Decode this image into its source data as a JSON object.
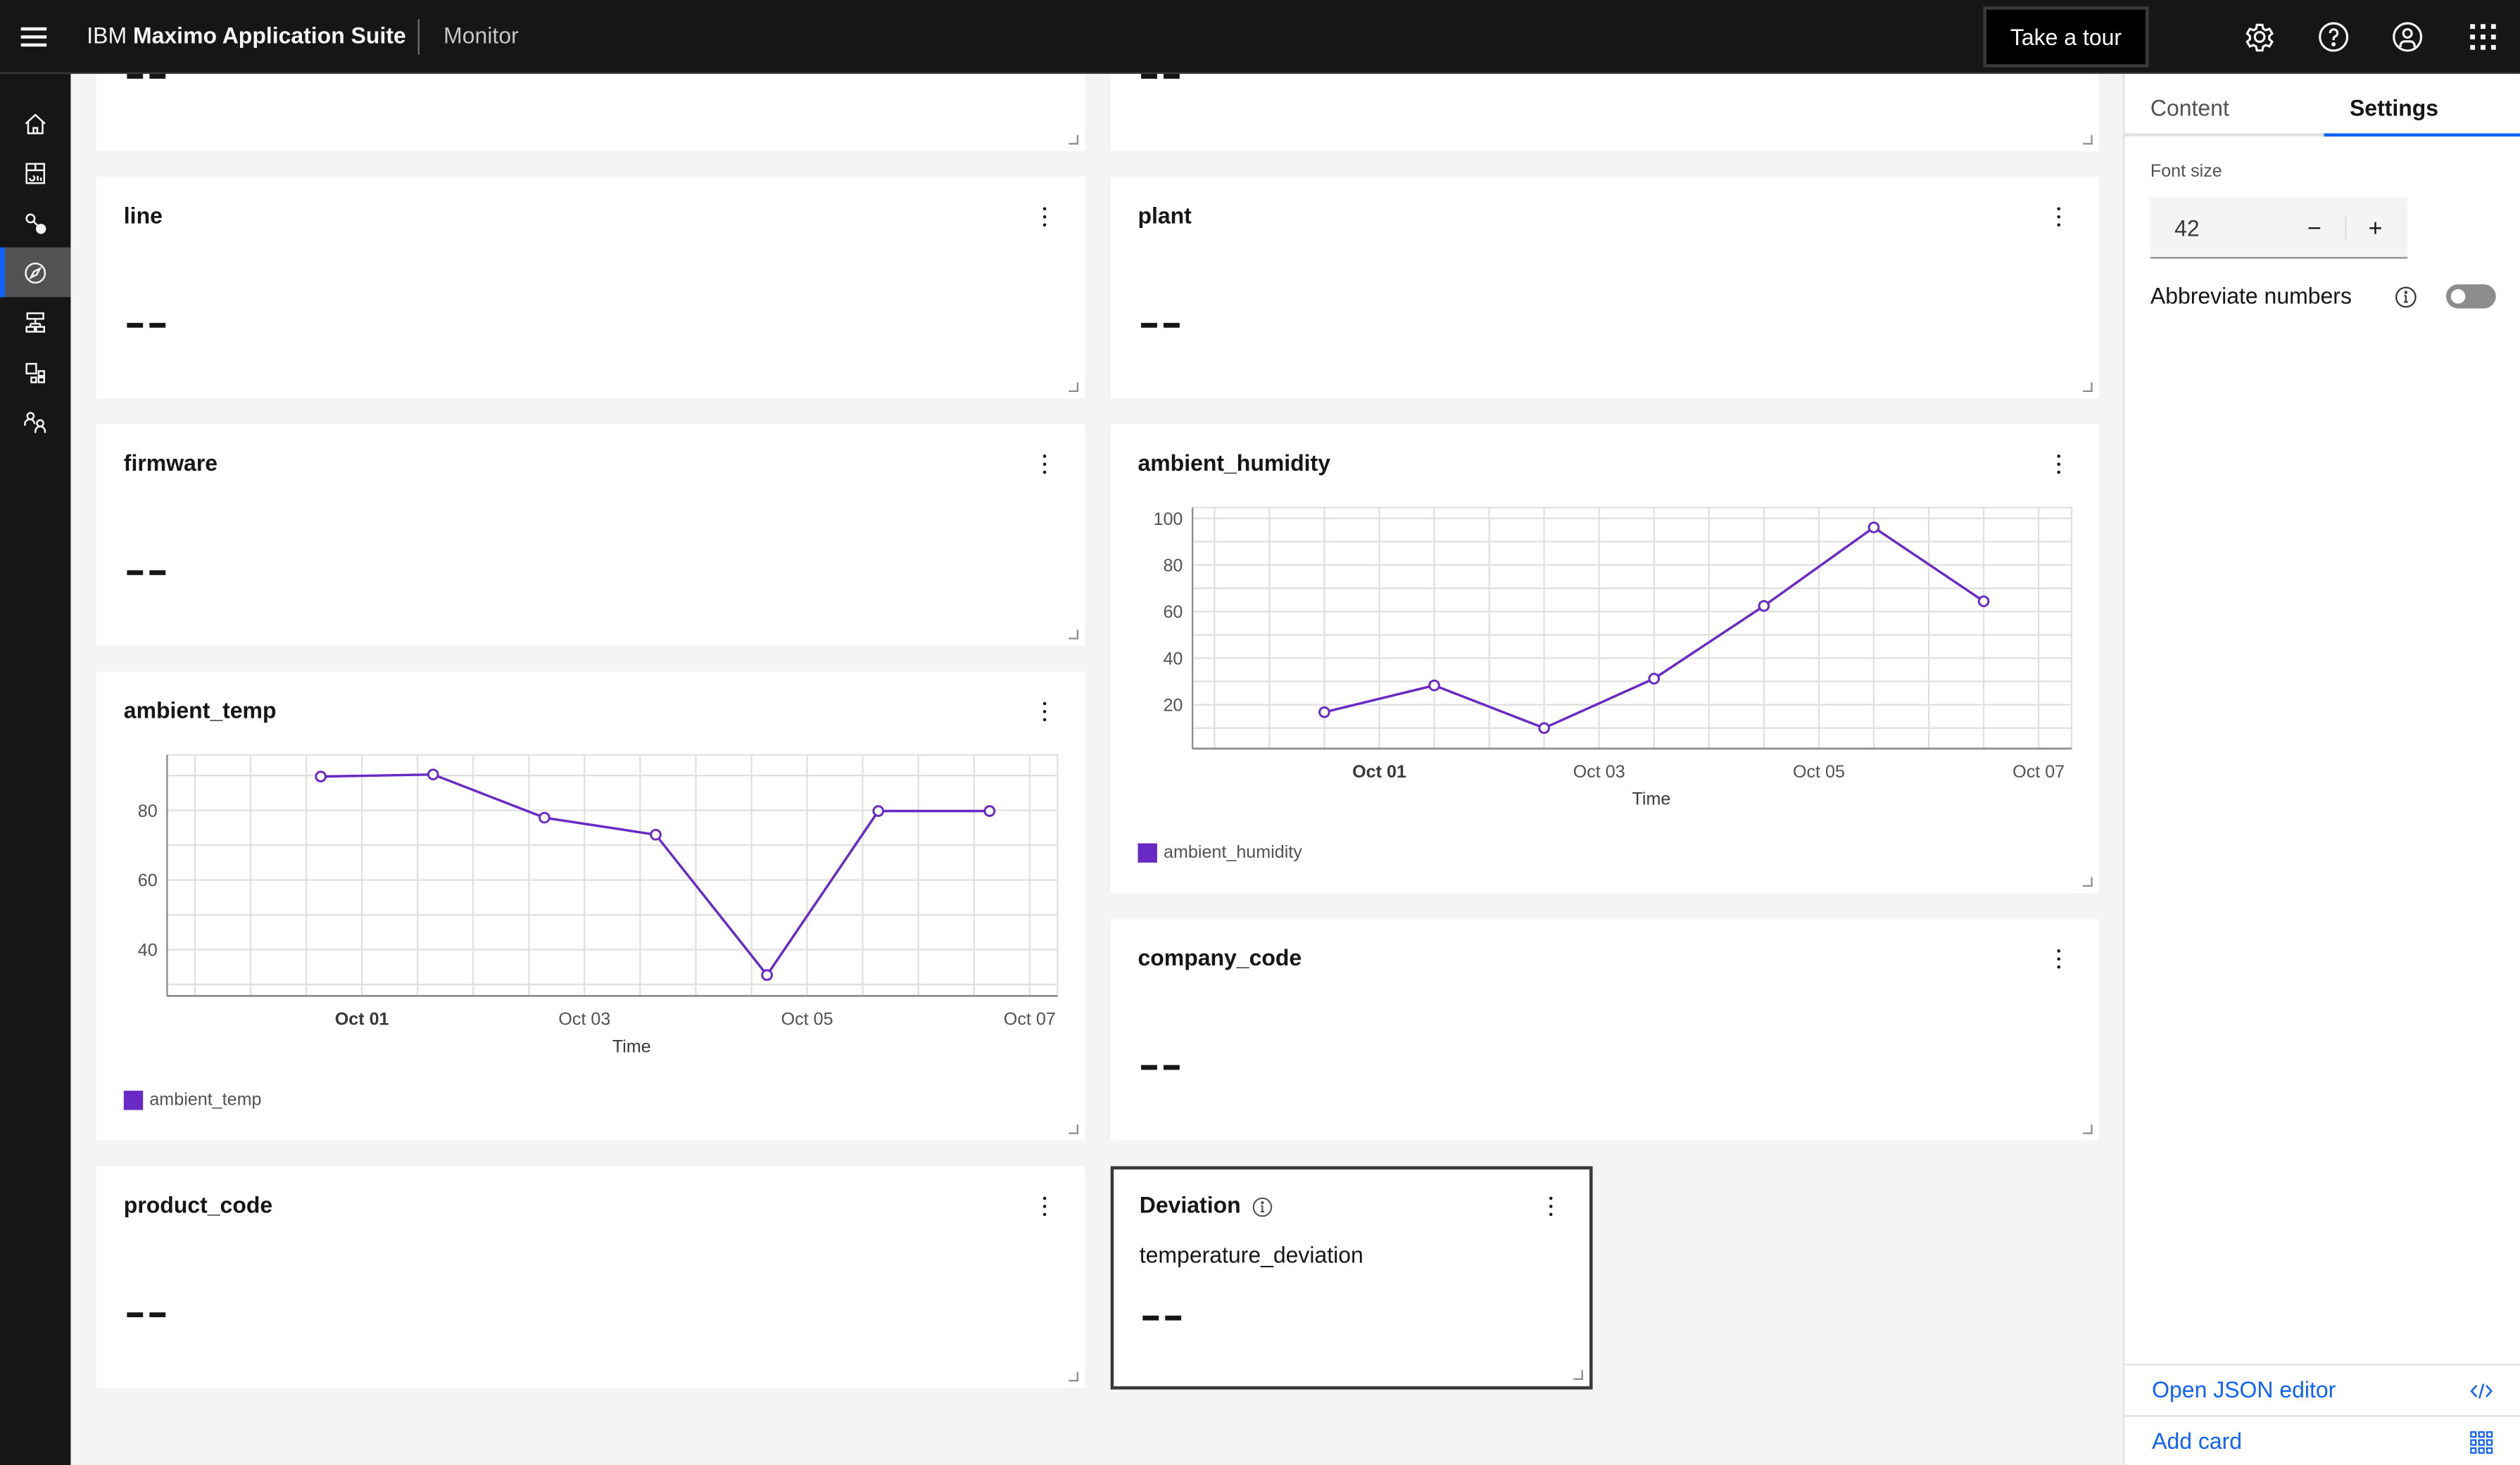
{
  "header": {
    "brand_prefix": "IBM",
    "brand_name": "Maximo Application Suite",
    "app_name": "Monitor",
    "tour_button": "Take a tour",
    "icons": [
      "settings-icon",
      "help-icon",
      "user-avatar-icon",
      "app-switcher-icon"
    ]
  },
  "leftnav": {
    "items": [
      {
        "name": "home",
        "icon": "home-icon",
        "active": false
      },
      {
        "name": "dashboards",
        "icon": "dashboard-icon",
        "active": false
      },
      {
        "name": "connect",
        "icon": "connect-icon",
        "active": false
      },
      {
        "name": "monitor",
        "icon": "compass-icon",
        "active": true
      },
      {
        "name": "hierarchy",
        "icon": "hierarchy-icon",
        "active": false
      },
      {
        "name": "apps",
        "icon": "apps-icon",
        "active": false
      },
      {
        "name": "users",
        "icon": "users-icon",
        "active": false
      }
    ]
  },
  "cards": {
    "top_left": {
      "title": "",
      "value": "--"
    },
    "top_right": {
      "title": "",
      "value": "--"
    },
    "line": {
      "title": "line",
      "value": "--"
    },
    "plant": {
      "title": "plant",
      "value": "--"
    },
    "firmware": {
      "title": "firmware",
      "value": "--"
    },
    "ambient_humidity": {
      "title": "ambient_humidity"
    },
    "ambient_temp": {
      "title": "ambient_temp"
    },
    "company_code": {
      "title": "company_code",
      "value": "--"
    },
    "product_code": {
      "title": "product_code",
      "value": "--"
    },
    "deviation": {
      "title": "Deviation",
      "subtitle": "temperature_deviation",
      "value": "--",
      "selected": true
    }
  },
  "chart_data": [
    {
      "type": "line",
      "title": "ambient_temp",
      "xlabel": "Time",
      "ylabel": "",
      "x_ticks": [
        "Oct 01",
        "Oct 03",
        "Oct 05",
        "Oct 07"
      ],
      "x_tick_bold": [
        "Oct 01"
      ],
      "x_days": [
        0.63,
        1.64,
        2.64,
        3.64,
        4.64,
        5.64,
        6.64
      ],
      "x_range_days": [
        -0.75,
        7.25
      ],
      "y_ticks": [
        40,
        60,
        80
      ],
      "ylim": [
        26.7,
        95.9
      ],
      "grid": true,
      "legend": "bottom-left",
      "color": "#6929c4",
      "series": [
        {
          "name": "ambient_temp",
          "values": [
            89.7,
            90.3,
            77.9,
            73.0,
            32.7,
            79.8,
            79.8
          ]
        }
      ]
    },
    {
      "type": "line",
      "title": "ambient_humidity",
      "xlabel": "Time",
      "ylabel": "",
      "x_ticks": [
        "Oct 01",
        "Oct 03",
        "Oct 05",
        "Oct 07"
      ],
      "x_tick_bold": [
        "Oct 01"
      ],
      "x_days": [
        0.5,
        1.5,
        2.5,
        3.5,
        4.5,
        5.5,
        6.5
      ],
      "x_range_days": [
        -0.7,
        7.3
      ],
      "y_ticks": [
        20,
        40,
        60,
        80,
        100
      ],
      "ylim": [
        1.2,
        104.6
      ],
      "grid": true,
      "legend": "bottom-left",
      "color": "#6929c4",
      "series": [
        {
          "name": "ambient_humidity",
          "values": [
            16.8,
            28.3,
            10.0,
            31.2,
            62.4,
            96.1,
            64.4
          ]
        }
      ]
    }
  ],
  "panel": {
    "tabs": [
      {
        "label": "Content",
        "selected": false
      },
      {
        "label": "Settings",
        "selected": true
      }
    ],
    "font_size_label": "Font size",
    "font_size_value": "42",
    "minus_label": "−",
    "plus_label": "+",
    "abbreviate_label": "Abbreviate numbers",
    "abbreviate_on": false,
    "open_json_label": "Open JSON editor",
    "add_card_label": "Add card",
    "link_color": "#0f62fe"
  }
}
